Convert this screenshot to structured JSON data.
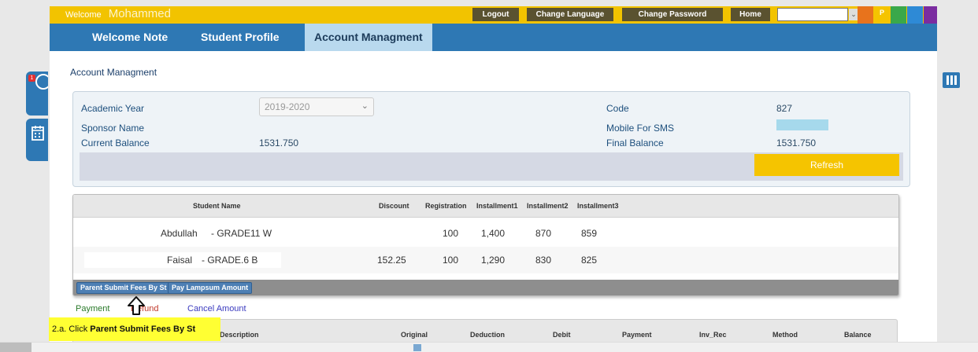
{
  "topbar": {
    "welcome_label": "Welcome",
    "user_name": "Mohammed",
    "logout": "Logout",
    "change_language": "Change Language",
    "change_password": "Change Password",
    "home": "Home",
    "p_label": "P",
    "colors": [
      "#e8731c",
      "#f5c400",
      "#3aa84a",
      "#2e8ad6",
      "#7b2ca0"
    ]
  },
  "nav": {
    "tabs": [
      {
        "label": "Welcome Note"
      },
      {
        "label": "Student Profile"
      },
      {
        "label": "Account Managment",
        "active": true
      }
    ]
  },
  "page": {
    "title": "Account Managment"
  },
  "info": {
    "academic_year_label": "Academic Year",
    "academic_year_value": "2019-2020",
    "sponsor_name_label": "Sponsor Name",
    "current_balance_label": "Current Balance",
    "current_balance_value": "1531.750",
    "code_label": "Code",
    "code_value": "827",
    "mobile_label": "Mobile For SMS",
    "final_balance_label": "Final Balance",
    "final_balance_value": "1531.750",
    "refresh_label": "Refresh"
  },
  "fees": {
    "headers": {
      "student_name": "Student Name",
      "discount": "Discount",
      "registration": "Registration",
      "installment1": "Installment1",
      "installment2": "Installment2",
      "installment3": "Installment3"
    },
    "rows": [
      {
        "name": "Abdullah",
        "grade": "- GRADE11 W",
        "discount": "",
        "registration": "100",
        "inst1": "1,400",
        "inst2": "870",
        "inst3": "859"
      },
      {
        "name": "Faisal",
        "grade": "- GRADE.6 B",
        "discount": "152.25",
        "registration": "100",
        "inst1": "1,290",
        "inst2": "830",
        "inst3": "825"
      }
    ],
    "parent_submit_label": "Parent Submit Fees By St",
    "pay_lampsum_label": "Pay Lampsum Amount"
  },
  "links": {
    "payment": "Payment",
    "refund": "Refund",
    "cancel_amount": "Cancel Amount"
  },
  "transactions": {
    "headers": {
      "description": "Description",
      "original": "Original",
      "deduction": "Deduction",
      "debit": "Debit",
      "payment": "Payment",
      "inv_rec": "Inv_Rec",
      "method": "Method",
      "balance": "Balance"
    }
  },
  "callout": {
    "prefix": "2.a. Click ",
    "bold": "Parent Submit Fees By St"
  }
}
